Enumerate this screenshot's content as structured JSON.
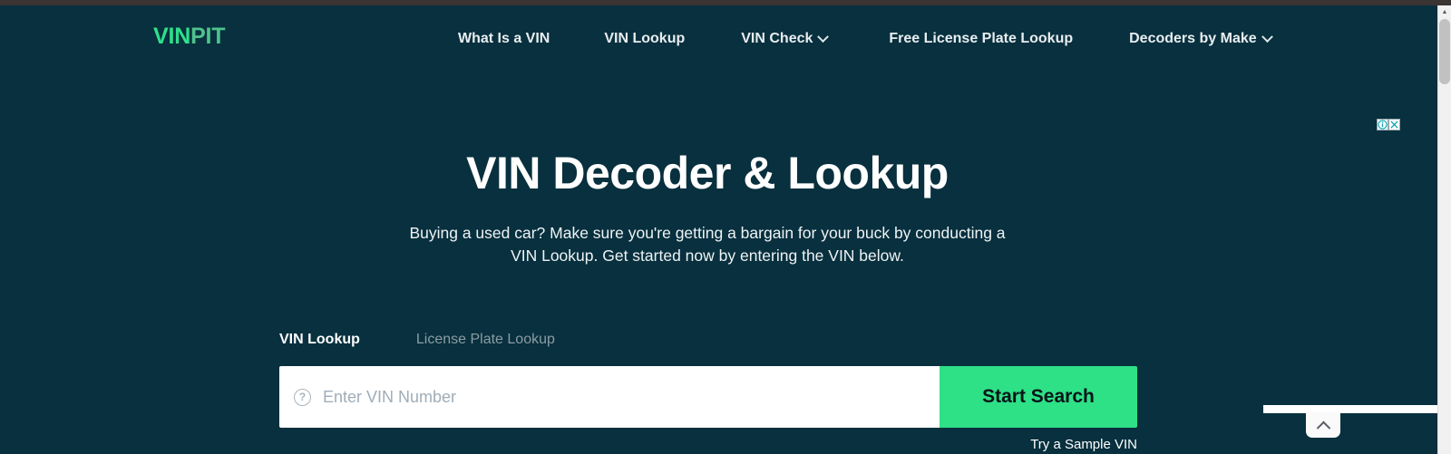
{
  "brand": {
    "name_primary": "VIN",
    "name_secondary": "PIT"
  },
  "nav": {
    "items": [
      {
        "label": "What Is a VIN",
        "has_dropdown": false,
        "icon": ""
      },
      {
        "label": "VIN Lookup",
        "has_dropdown": false,
        "icon": ""
      },
      {
        "label": "VIN Check",
        "has_dropdown": true,
        "icon": "chevron-down-icon"
      },
      {
        "label": "Free License Plate Lookup",
        "has_dropdown": false,
        "icon": ""
      },
      {
        "label": "Decoders by Make",
        "has_dropdown": true,
        "icon": "chevron-down-icon"
      }
    ]
  },
  "hero": {
    "title": "VIN Decoder & Lookup",
    "subtitle": "Buying a used car? Make sure you're getting a bargain for your buck by conducting a VIN Lookup. Get started now by entering the VIN below."
  },
  "lookup": {
    "tabs": [
      {
        "label": "VIN Lookup",
        "active": true
      },
      {
        "label": "License Plate Lookup",
        "active": false
      }
    ],
    "input": {
      "value": "",
      "placeholder": "Enter VIN Number",
      "help_icon": "question-mark-circle-icon"
    },
    "submit_label": "Start Search",
    "sample_link_label": "Try a Sample VIN"
  },
  "ad": {
    "adchoices_info_icon": "info-circle-icon",
    "adchoices_close_icon": "close-x-icon",
    "sticky_collapse_icon": "chevron-up-icon"
  },
  "colors": {
    "page_background": "#08303e",
    "brand_green": "#2ee08a",
    "brand_green_muted": "#4fc28c",
    "button_green": "#2ee086",
    "text_primary": "#ffffff",
    "text_muted": "#8b9ca5",
    "input_background": "#ffffff",
    "placeholder": "#9fadb8",
    "browser_chrome": "#3a3432",
    "adchoices_cyan": "#00a0b0"
  },
  "scrollbar": {
    "up_arrow_icon": "triangle-up-icon",
    "position": "top"
  }
}
